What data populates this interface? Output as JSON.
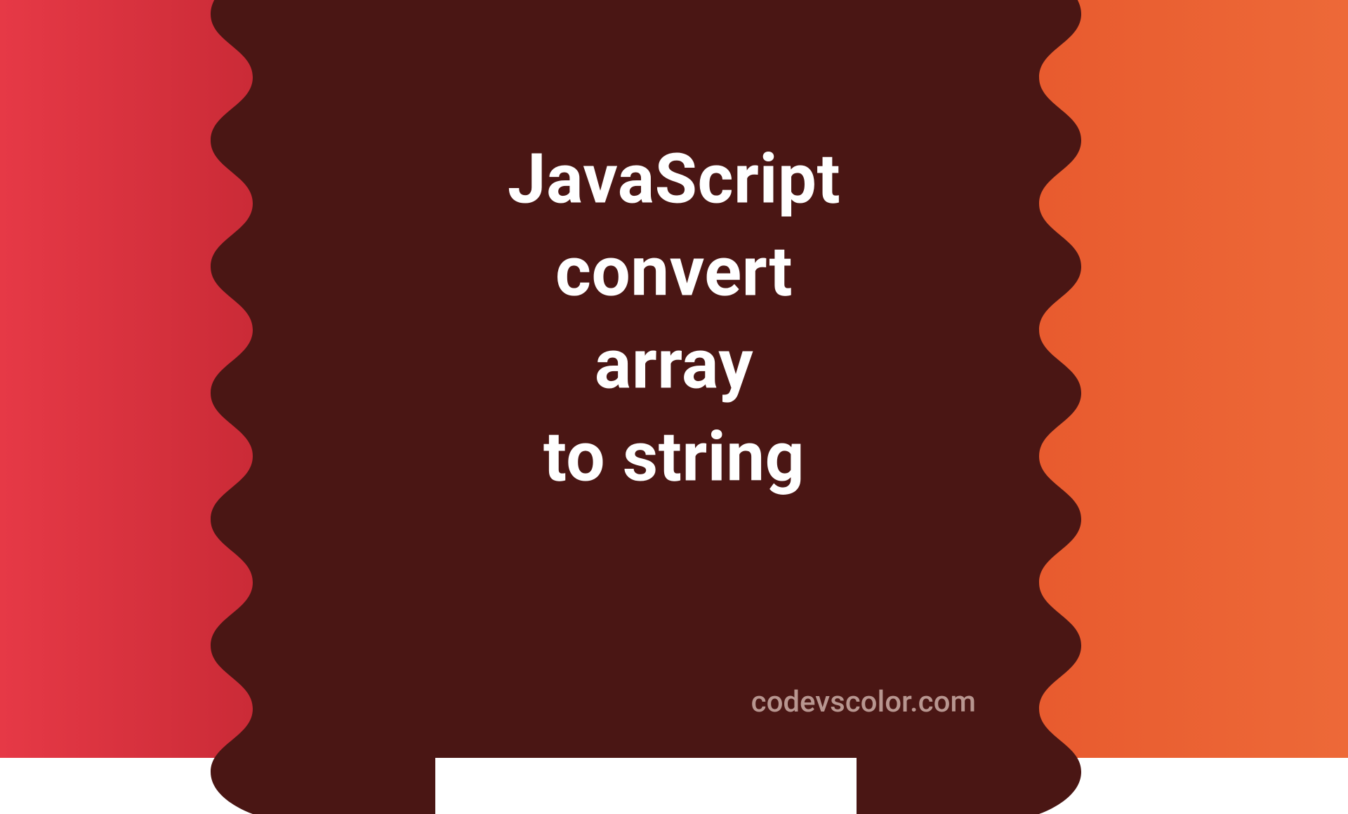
{
  "title": {
    "line1": "JavaScript",
    "line2": "convert",
    "line3": "array",
    "line4": "to string"
  },
  "watermark": "codevscolor.com",
  "colors": {
    "background_dark": "#4a1614",
    "left_red_start": "#e63946",
    "left_red_end": "#c92a36",
    "right_orange_start": "#e85a2e",
    "right_orange_end": "#ed6938",
    "text": "#ffffff",
    "watermark": "#b89690"
  }
}
